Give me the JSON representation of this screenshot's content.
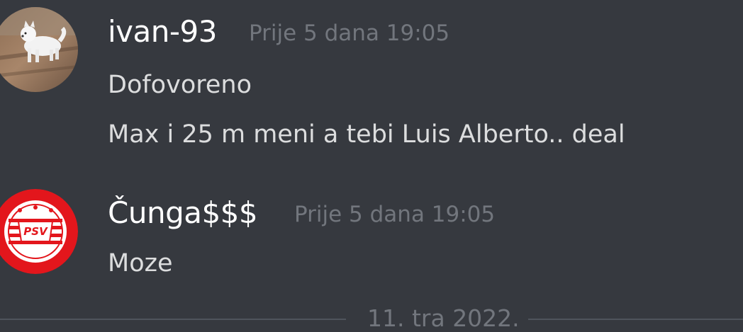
{
  "messages": [
    {
      "author": "ivan-93",
      "timestamp": "Prije 5 dana 19:05",
      "avatar_icon": "dog-photo-avatar",
      "lines": [
        "Dofovoreno",
        "Max i 25 m meni a tebi Luis Alberto.. deal"
      ]
    },
    {
      "author": "Čunga$$$",
      "timestamp": "Prije 5 dana 19:05",
      "avatar_icon": "psv-logo-avatar",
      "avatar_text": "PSV",
      "lines": [
        "Moze"
      ]
    }
  ],
  "date_divider": "11. tra 2022.",
  "colors": {
    "background": "#36393f",
    "username": "#ffffff",
    "message_text": "#dcddde",
    "timestamp": "#72767d",
    "psv_red": "#e3161c"
  }
}
